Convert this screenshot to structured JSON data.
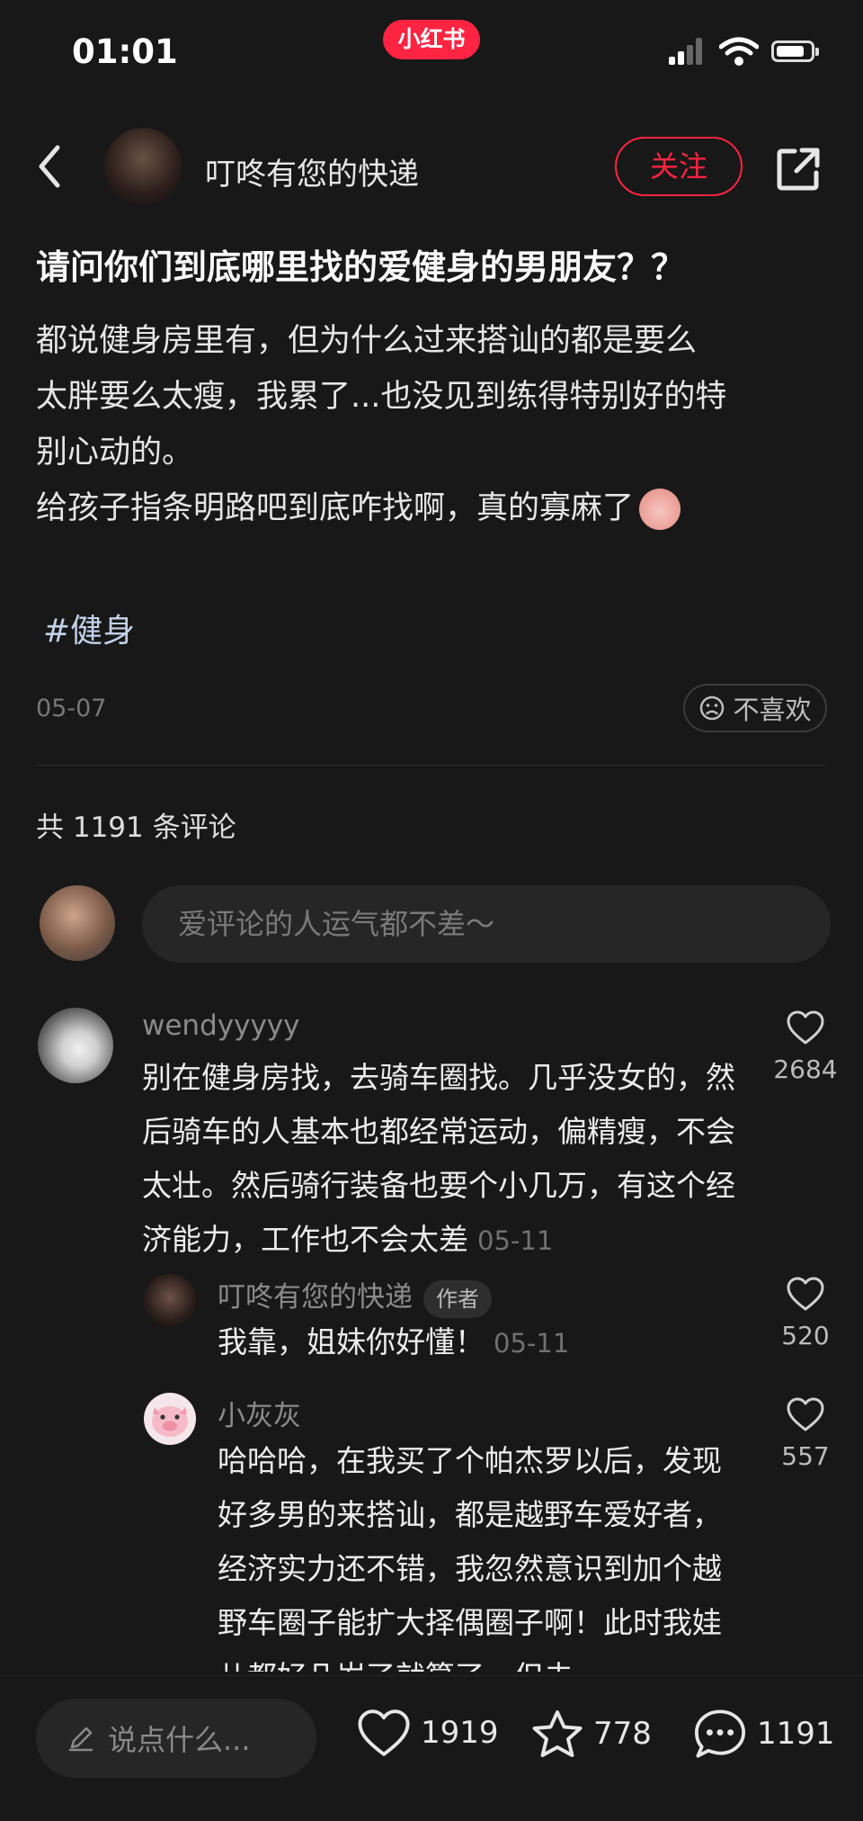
{
  "status_bar": {
    "time": "01:01",
    "app_badge": "小红书"
  },
  "header": {
    "author_name": "叮咚有您的快递",
    "follow_label": "关注"
  },
  "post": {
    "title": "请问你们到底哪里找的爱健身的男朋友？？",
    "body_lines": [
      "都说健身房里有，但为什么过来搭讪的都是要么",
      "太胖要么太瘦，我累了...也没见到练得特别好的特",
      "别心动的。",
      "给孩子指条明路吧到底咋找啊，真的寡麻了"
    ],
    "hashtag": "#健身",
    "date": "05-07",
    "dislike_label": "不喜欢"
  },
  "comments_section": {
    "count_label": "共 1191 条评论",
    "input_placeholder": "爱评论的人运气都不差～"
  },
  "comments": [
    {
      "user": "wendyyyyy",
      "text": "别在健身房找，去骑车圈找。几乎没女的，然后骑车的人基本也都经常运动，偏精瘦，不会太壮。然后骑行装备也要个小几万，有这个经济能力，工作也不会太差",
      "time": "05-11",
      "likes": "2684",
      "replies": [
        {
          "user": "叮咚有您的快递",
          "tag": "作者",
          "text": "我靠，姐妹你好懂！",
          "time": "05-11",
          "likes": "520"
        },
        {
          "user": "小灰灰",
          "text": "哈哈哈，在我买了个帕杰罗以后，发现好多男的来搭讪，都是越野车爱好者，经济实力还不错，我忽然意识到加个越野车圈子能扩大择偶圈子啊！此时我娃儿都好几岁了就算了，但未",
          "likes": "557"
        }
      ]
    }
  ],
  "bottom_bar": {
    "input_placeholder": "说点什么...",
    "likes": "1919",
    "favorites": "778",
    "comments": "1191"
  },
  "colors": {
    "background": "#181818",
    "brand_red": "#ff2442"
  },
  "icons": [
    "back-arrow-icon",
    "share-icon",
    "hashtag",
    "dislike-face-icon",
    "heart-icon",
    "star-icon",
    "comment-bubble-icon",
    "pencil-icon"
  ]
}
